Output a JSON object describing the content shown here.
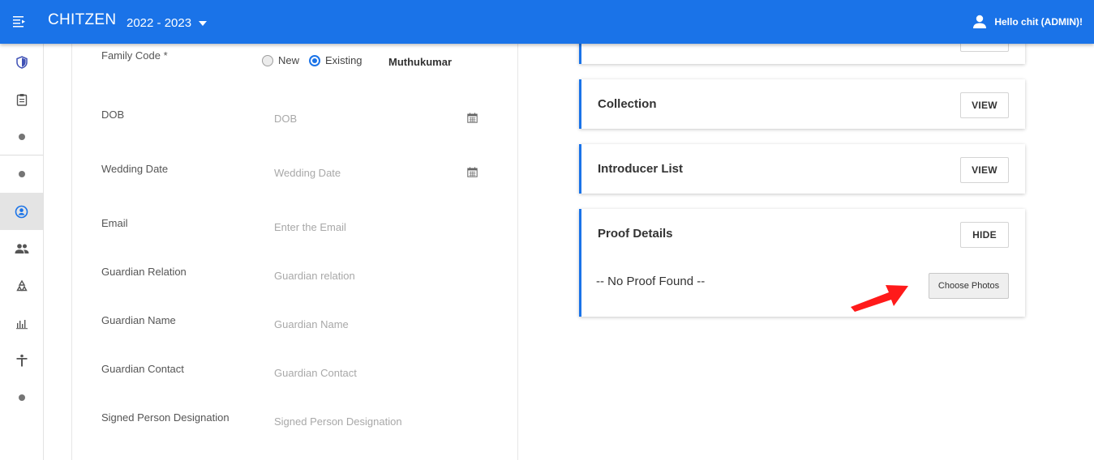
{
  "header": {
    "brand": "CHITZEN",
    "year": "2022 - 2023",
    "user_greeting": "Hello chit (ADMIN)!"
  },
  "sidebar": {
    "items": [
      {
        "icon": "shield-icon"
      },
      {
        "icon": "clipboard-icon"
      },
      {
        "icon": "dot-icon"
      },
      {
        "icon": "dot-icon"
      },
      {
        "icon": "account-circle-icon",
        "active": true
      },
      {
        "icon": "people-icon"
      },
      {
        "icon": "recycle-icon"
      },
      {
        "icon": "bar-chart-icon"
      },
      {
        "icon": "accessibility-icon"
      },
      {
        "icon": "dot-icon"
      }
    ]
  },
  "form": {
    "family_code": {
      "label": "Family Code *",
      "options": [
        "New",
        "Existing"
      ],
      "selected": "Existing",
      "value": "Muthukumar"
    },
    "dob": {
      "label": "DOB",
      "placeholder": "DOB"
    },
    "wedding_date": {
      "label": "Wedding Date",
      "placeholder": "Wedding Date"
    },
    "email": {
      "label": "Email",
      "placeholder": "Enter the Email"
    },
    "guardian_relation": {
      "label": "Guardian Relation",
      "placeholder": "Guardian relation"
    },
    "guardian_name": {
      "label": "Guardian Name",
      "placeholder": "Guardian Name"
    },
    "guardian_contact": {
      "label": "Guardian Contact",
      "placeholder": "Guardian Contact"
    },
    "signed_person_designation": {
      "label": "Signed Person Designation",
      "placeholder": "Signed Person Designation"
    }
  },
  "cards": {
    "collection": {
      "title": "Collection",
      "button": "VIEW"
    },
    "introducer_list": {
      "title": "Introducer List",
      "button": "VIEW"
    },
    "proof_details": {
      "title": "Proof Details",
      "button": "HIDE",
      "empty_text": "-- No Proof Found --",
      "upload_button": "Choose Photos"
    }
  },
  "colors": {
    "primary": "#1a73e8",
    "annotation_arrow": "#ff1a1a"
  }
}
